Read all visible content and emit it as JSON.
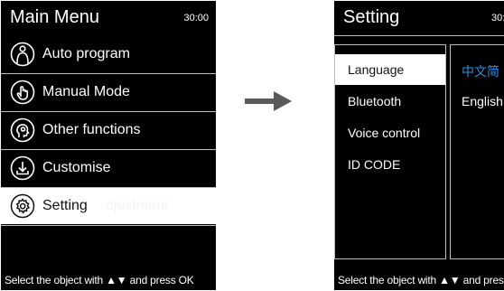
{
  "main_menu": {
    "title": "Main Menu",
    "timer": "30:00",
    "items": [
      {
        "label": "Auto program",
        "icon": "body-silhouette-icon",
        "selected": false
      },
      {
        "label": "Manual Mode",
        "icon": "hand-icon",
        "selected": false
      },
      {
        "label": "Other functions",
        "icon": "head-profile-icon",
        "selected": false
      },
      {
        "label": "Customise",
        "icon": "download-icon",
        "selected": false
      },
      {
        "label": "Setting",
        "icon": "gear-icon",
        "selected": true,
        "faded_text": "djustment"
      }
    ],
    "footer": "Select the object with ▲▼ and press OK"
  },
  "flow_arrow_icon": "right-arrow-icon",
  "setting": {
    "title": "Setting",
    "timer": "30:",
    "options": [
      {
        "label": "Language",
        "selected": true
      },
      {
        "label": "Bluetooth",
        "selected": false
      },
      {
        "label": "Voice control",
        "selected": false
      },
      {
        "label": "ID CODE",
        "selected": false
      }
    ],
    "languages": [
      {
        "label": "中文简",
        "active": true
      },
      {
        "label": "English",
        "active": false
      }
    ],
    "footer": "Select the object with ▲▼ and press O"
  },
  "colors": {
    "screen_bg": "#000000",
    "highlight_bg": "#ffffff",
    "active_language": "#2e8fdc",
    "arrow": "#5a5a5a"
  }
}
